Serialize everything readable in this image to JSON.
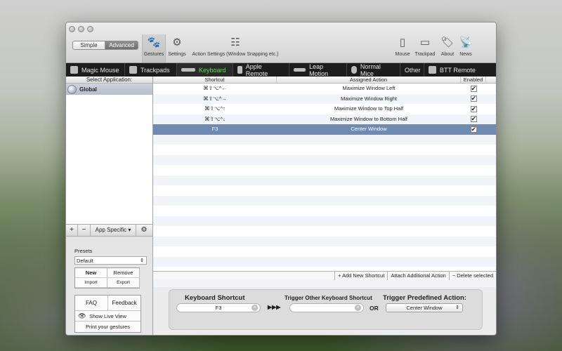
{
  "mode": {
    "simple": "Simple",
    "advanced": "Advanced"
  },
  "toolbar": {
    "left": [
      {
        "id": "gestures",
        "label": "Gestures",
        "icon": "paw-icon",
        "glyph": "🐾"
      },
      {
        "id": "settings",
        "label": "Settings",
        "icon": "gears-icon",
        "glyph": "⚙"
      },
      {
        "id": "action-settings",
        "label": "Action Settings (Window Snapping etc.)",
        "icon": "sliders-icon",
        "glyph": "☷"
      }
    ],
    "right": [
      {
        "id": "mouse",
        "label": "Mouse",
        "icon": "mouse-icon",
        "glyph": "▯"
      },
      {
        "id": "trackpad",
        "label": "Trackpad",
        "icon": "trackpad-icon",
        "glyph": "▭"
      },
      {
        "id": "about",
        "label": "About",
        "icon": "tag-icon",
        "glyph": "🏷"
      },
      {
        "id": "news",
        "label": "News",
        "icon": "antenna-icon",
        "glyph": "📡"
      }
    ]
  },
  "tabs": [
    {
      "label": "Magic Mouse"
    },
    {
      "label": "Trackpads"
    },
    {
      "label": "Keyboard"
    },
    {
      "label": "Apple Remote"
    },
    {
      "label": "Leap Motion"
    },
    {
      "label": "Normal Mice"
    },
    {
      "label": "Other"
    },
    {
      "label": "BTT Remote"
    }
  ],
  "sidebar": {
    "header": "Select Application:",
    "apps": [
      {
        "name": "Global"
      }
    ],
    "add": "+",
    "remove": "−",
    "app_specific": "App Specific ▾",
    "gear": "⚙"
  },
  "presets": {
    "label": "Presets",
    "selected": "Default",
    "new": "New",
    "remove": "Remove",
    "import": "Import",
    "export": "Export"
  },
  "help": {
    "faq": "FAQ",
    "feedback": "Feedback",
    "live_view": "Show Live View",
    "print": "Print your gestures"
  },
  "table": {
    "headers": {
      "shortcut": "Shortcut",
      "action": "Assigned Action",
      "enabled": "Enabled"
    },
    "rows": [
      {
        "shortcut": "⌘⇧⌥^←",
        "action": "Maximize Window Left",
        "enabled": "✔"
      },
      {
        "shortcut": "⌘⇧⌥^→",
        "action": "Maximize Window Right",
        "enabled": "✔"
      },
      {
        "shortcut": "⌘⇧⌥^↑",
        "action": "Maximize Window to Top Half",
        "enabled": "✔"
      },
      {
        "shortcut": "⌘⇧⌥^↓",
        "action": "Maximize Window to Bottom Half",
        "enabled": "✔"
      },
      {
        "shortcut": "F3",
        "action": "Center Window",
        "enabled": "✔"
      }
    ]
  },
  "actions": {
    "add": "+ Add New Shortcut",
    "attach": "Attach Additional Action",
    "delete": "− Delete selected"
  },
  "bottom": {
    "kb_label": "Keyboard Shortcut",
    "kb_value": "F3",
    "arrows": "▶▶▶",
    "other_label": "Trigger Other Keyboard Shortcut",
    "other_value": "",
    "or": "OR",
    "predef_label": "Trigger Predefined Action:",
    "predef_value": "Center Window"
  }
}
